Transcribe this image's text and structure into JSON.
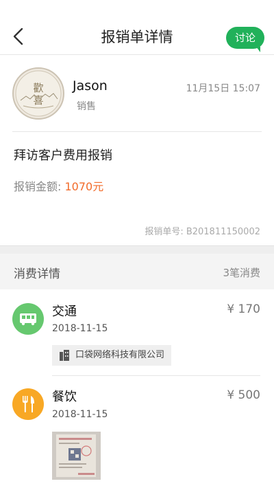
{
  "header": {
    "title": "报销单详情",
    "discuss_label": "讨论"
  },
  "profile": {
    "name": "Jason",
    "role": "销售",
    "time": "11月15日 15:07",
    "avatar_text": "歡喜"
  },
  "report": {
    "description": "拜访客户费用报销",
    "amount_label": "报销金额: ",
    "amount_value": "1070元",
    "order_no": "报销单号: B201811150002"
  },
  "expenses": {
    "section_title": "消费详情",
    "count": "3笔消费",
    "items": [
      {
        "category": "交通",
        "date": "2018-11-15",
        "price": "¥ 170",
        "icon": "bus-icon",
        "company": "口袋网络科技有限公司"
      },
      {
        "category": "餐饮",
        "date": "2018-11-15",
        "price": "¥ 500",
        "icon": "fork-knife-icon"
      }
    ]
  },
  "colors": {
    "accent_green": "#21b15a",
    "amount_orange": "#f26b2a",
    "transport_green": "#66c86f",
    "food_orange": "#f8a825"
  }
}
